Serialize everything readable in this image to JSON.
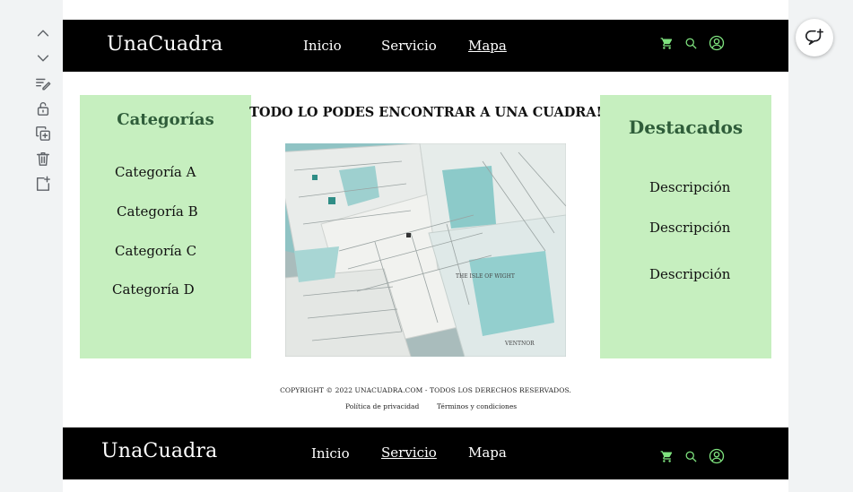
{
  "editor": {
    "tools": [
      {
        "icon": "chevron-up-icon",
        "label": "move-up"
      },
      {
        "icon": "chevron-down-icon",
        "label": "move-down"
      },
      {
        "icon": "edit-icon",
        "label": "edit"
      },
      {
        "icon": "unlock-icon",
        "label": "unlock"
      },
      {
        "icon": "duplicate-icon",
        "label": "duplicate"
      },
      {
        "icon": "trash-icon",
        "label": "delete"
      },
      {
        "icon": "add-section-icon",
        "label": "add"
      }
    ],
    "comment_button_icon": "add-comment-icon"
  },
  "header": {
    "brand": "UnaCuadra",
    "nav": [
      "Inicio",
      "Servicio",
      "Mapa"
    ],
    "active": "Mapa",
    "icons": [
      "cart-icon",
      "search-icon",
      "user-icon"
    ],
    "icon_color": "#7ee27e"
  },
  "categories": {
    "title": "Categorías",
    "items": [
      "Categoría A",
      "Categoría B",
      "Categoría C",
      "Categoría D"
    ]
  },
  "headline": "TODO LO PODES ENCONTRAR A UNA CUADRA!",
  "featured": {
    "title": "Destacados",
    "items": [
      "Descripción",
      "Descripción",
      "Descripción"
    ]
  },
  "footer": {
    "copyright": "COPYRIGHT © 2022 UNACUADRA.COM - TODOS LOS DERECHOS RESERVADOS.",
    "privacy": "Política de privacidad",
    "terms": "Términos y condiciones"
  },
  "bottom_header": {
    "brand": "UnaCuadra",
    "nav": [
      "Inicio",
      "Servicio",
      "Mapa"
    ],
    "active": "Servicio"
  },
  "colors": {
    "panel_bg": "#c6efbf",
    "panel_title": "#2f5d3a",
    "navbar_bg": "#000000"
  }
}
